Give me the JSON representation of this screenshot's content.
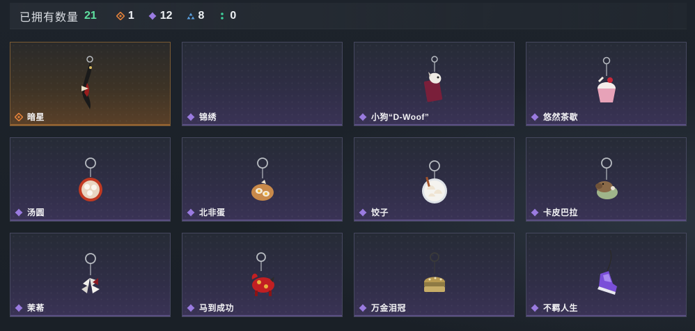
{
  "header": {
    "owned_label": "已拥有数量",
    "owned_count": "21",
    "rarity_counts": [
      {
        "icon": "orange-diamond-icon",
        "color": "#e0803a",
        "value": "1"
      },
      {
        "icon": "purple-diamond-icon",
        "color": "#9a7be0",
        "value": "12"
      },
      {
        "icon": "blue-triangle-icon",
        "color": "#5aa0e0",
        "value": "8"
      },
      {
        "icon": "green-dots-icon",
        "color": "#3fcf9a",
        "value": "0"
      }
    ]
  },
  "colors": {
    "rare_orange": "#e0803a",
    "epic_purple": "#9a7be0",
    "owned_green": "#5fe0a0"
  },
  "charms": [
    {
      "name": "暗星",
      "rarity": "orange",
      "icon": "dark-star-charm-icon"
    },
    {
      "name": "锦绣",
      "rarity": "purple",
      "icon": "empty-slot"
    },
    {
      "name": "小狗“D-Woof”",
      "rarity": "purple",
      "icon": "dog-book-charm-icon"
    },
    {
      "name": "悠然茶歇",
      "rarity": "purple",
      "icon": "cupcake-charm-icon"
    },
    {
      "name": "汤圆",
      "rarity": "purple",
      "icon": "tangyuan-bowl-charm-icon"
    },
    {
      "name": "北非蛋",
      "rarity": "purple",
      "icon": "shakshuka-pan-charm-icon"
    },
    {
      "name": "饺子",
      "rarity": "purple",
      "icon": "dumpling-plate-charm-icon"
    },
    {
      "name": "卡皮巴拉",
      "rarity": "purple",
      "icon": "capybara-charm-icon"
    },
    {
      "name": "茉莃",
      "rarity": "purple",
      "icon": "flower-charm-icon"
    },
    {
      "name": "马到成功",
      "rarity": "purple",
      "icon": "red-horse-charm-icon"
    },
    {
      "name": "万金泪冠",
      "rarity": "purple",
      "icon": "gold-crown-charm-icon"
    },
    {
      "name": "不羁人生",
      "rarity": "purple",
      "icon": "purple-sneaker-charm-icon"
    }
  ]
}
